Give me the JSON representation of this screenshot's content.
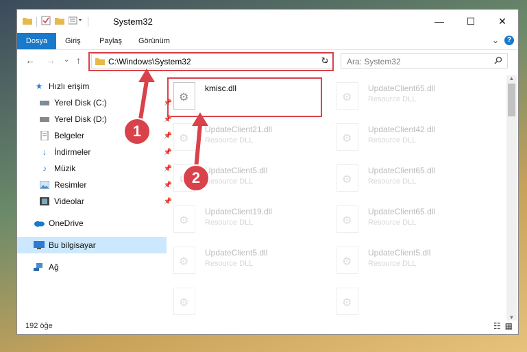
{
  "window": {
    "title": "System32",
    "controls": [
      "—",
      "☐",
      "✕"
    ]
  },
  "ribbon": {
    "tabs": [
      "Dosya",
      "Giriş",
      "Paylaş",
      "Görünüm"
    ],
    "expand": "⌄",
    "help": "?"
  },
  "nav": {
    "back": "←",
    "forward": "→",
    "recent": "⌄",
    "up": "↑"
  },
  "address": {
    "path": "C:\\Windows\\System32",
    "chevron": "⌄",
    "refresh": "↻"
  },
  "search": {
    "placeholder": "Ara: System32"
  },
  "sidebar": {
    "items": [
      {
        "label": "Hızlı erişim",
        "icon": "star-icon",
        "pinned": false
      },
      {
        "label": "Yerel Disk (C:)",
        "icon": "drive-icon",
        "pinned": true
      },
      {
        "label": "Yerel Disk (D:)",
        "icon": "drive-icon",
        "pinned": true
      },
      {
        "label": "Belgeler",
        "icon": "document-icon",
        "pinned": true
      },
      {
        "label": "İndirmeler",
        "icon": "download-icon",
        "pinned": true
      },
      {
        "label": "Müzik",
        "icon": "music-icon",
        "pinned": true
      },
      {
        "label": "Resimler",
        "icon": "picture-icon",
        "pinned": true
      },
      {
        "label": "Videolar",
        "icon": "video-icon",
        "pinned": true
      },
      {
        "label": "OneDrive",
        "icon": "cloud-icon",
        "pinned": false
      },
      {
        "label": "Bu bilgisayar",
        "icon": "computer-icon",
        "pinned": false
      },
      {
        "label": "Ağ",
        "icon": "network-icon",
        "pinned": false
      }
    ]
  },
  "files": [
    {
      "name": "kmisc.dll",
      "type": ""
    },
    {
      "name": "UpdateClient65.dll",
      "type": "Resource DLL"
    },
    {
      "name": "UpdateClient21.dll",
      "type": "Resource DLL"
    },
    {
      "name": "UpdateClient42.dll",
      "type": "Resource DLL"
    },
    {
      "name": "UpdateClient5.dll",
      "type": "Resource DLL"
    },
    {
      "name": "UpdateClient65.dll",
      "type": "Resource DLL"
    },
    {
      "name": "UpdateClient19.dll",
      "type": "Resource DLL"
    },
    {
      "name": "UpdateClient65.dll",
      "type": "Resource DLL"
    },
    {
      "name": "UpdateClient5.dll",
      "type": "Resource DLL"
    },
    {
      "name": "UpdateClient5.dll",
      "type": "Resource DLL"
    },
    {
      "name": "",
      "type": ""
    },
    {
      "name": "",
      "type": ""
    }
  ],
  "status": {
    "count": "192 öğe"
  },
  "annotations": {
    "step1": "1",
    "step2": "2",
    "color": "#d9424a"
  },
  "colors": {
    "accent": "#1979ca",
    "selected": "#cce8ff"
  }
}
